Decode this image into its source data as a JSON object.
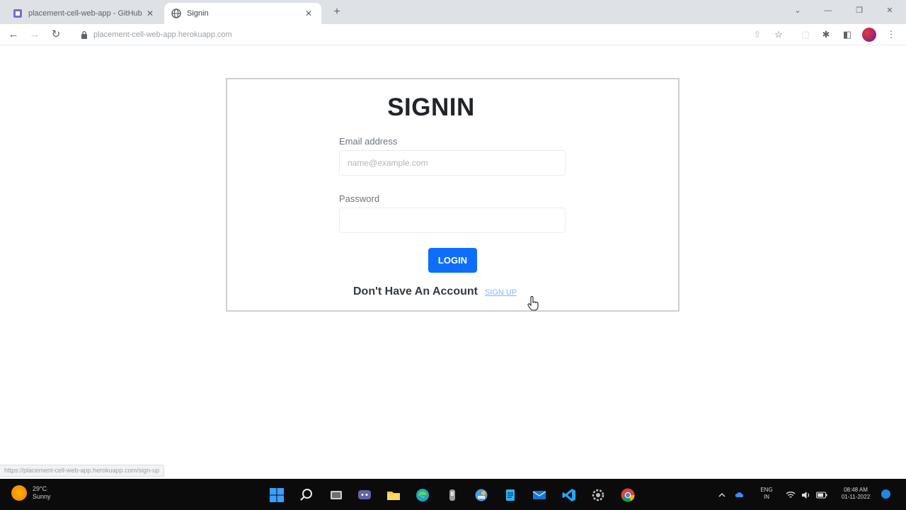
{
  "browser": {
    "tabs": [
      {
        "title": "placement-cell-web-app - GitHub",
        "active": false
      },
      {
        "title": "Signin",
        "active": true
      }
    ],
    "url": "placement-cell-web-app.herokuapp.com",
    "status_url": "https://placement-cell-web-app.herokuapp.com/sign-up"
  },
  "page": {
    "heading": "SIGNIN",
    "email": {
      "label": "Email address",
      "placeholder": "name@example.com",
      "value": ""
    },
    "password": {
      "label": "Password",
      "value": ""
    },
    "login_button": "LOGIN",
    "signup_prompt": "Don't Have An Account",
    "signup_link": "SIGN UP"
  },
  "taskbar": {
    "weather_temp": "29°C",
    "weather_desc": "Sunny",
    "lang_top": "ENG",
    "lang_bottom": "IN",
    "time": "08:48 AM",
    "date": "01-11-2022"
  },
  "colors": {
    "primary_button": "#0d6efd",
    "link": "#8ab4f8"
  }
}
